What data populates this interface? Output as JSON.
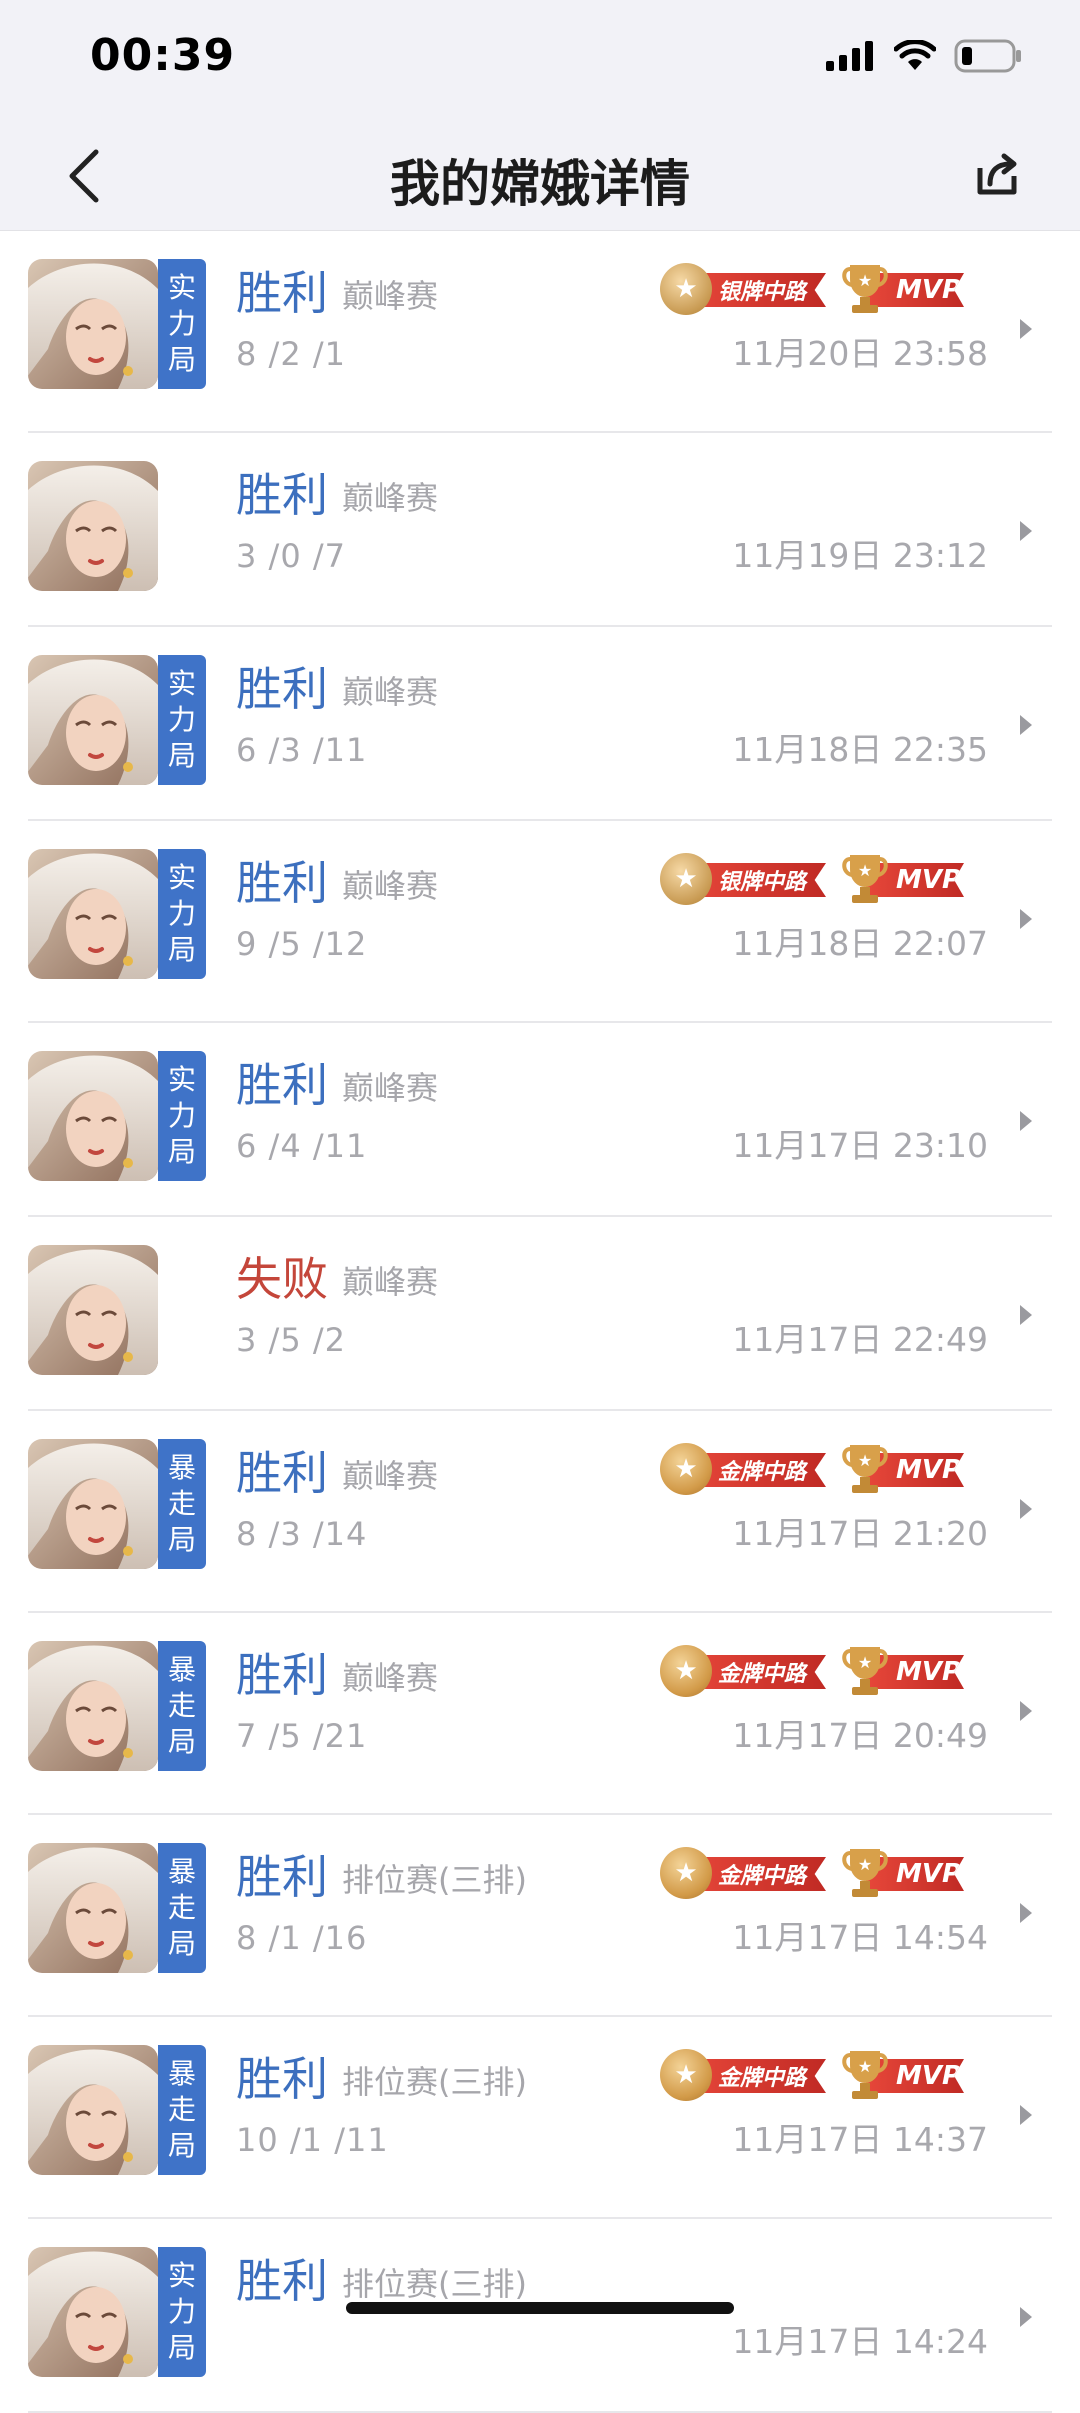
{
  "status_bar": {
    "time": "00:39"
  },
  "nav": {
    "title": "我的嫦娥详情"
  },
  "badge_labels": {
    "silver_mid": "银牌中路",
    "gold_mid": "金牌中路",
    "mvp": "MVP"
  },
  "colors": {
    "win": "#3c6fbe",
    "lose": "#c4463a",
    "tag_bg": "#3f73c8",
    "ribbon_red": "#d8372e"
  },
  "matches": [
    {
      "tag": [
        "实",
        "力",
        "局"
      ],
      "result": "胜利",
      "outcome": "win",
      "mode": "巅峰赛",
      "kda": "8 /2 /1",
      "date": "11月20日 23:58",
      "medal": "silver",
      "mvp": true
    },
    {
      "tag": [],
      "result": "胜利",
      "outcome": "win",
      "mode": "巅峰赛",
      "kda": "3 /0 /7",
      "date": "11月19日 23:12",
      "medal": null,
      "mvp": false
    },
    {
      "tag": [
        "实",
        "力",
        "局"
      ],
      "result": "胜利",
      "outcome": "win",
      "mode": "巅峰赛",
      "kda": "6 /3 /11",
      "date": "11月18日 22:35",
      "medal": null,
      "mvp": false
    },
    {
      "tag": [
        "实",
        "力",
        "局"
      ],
      "result": "胜利",
      "outcome": "win",
      "mode": "巅峰赛",
      "kda": "9 /5 /12",
      "date": "11月18日 22:07",
      "medal": "silver",
      "mvp": true
    },
    {
      "tag": [
        "实",
        "力",
        "局"
      ],
      "result": "胜利",
      "outcome": "win",
      "mode": "巅峰赛",
      "kda": "6 /4 /11",
      "date": "11月17日 23:10",
      "medal": null,
      "mvp": false
    },
    {
      "tag": [],
      "result": "失败",
      "outcome": "lose",
      "mode": "巅峰赛",
      "kda": "3 /5 /2",
      "date": "11月17日 22:49",
      "medal": null,
      "mvp": false
    },
    {
      "tag": [
        "暴",
        "走",
        "局"
      ],
      "result": "胜利",
      "outcome": "win",
      "mode": "巅峰赛",
      "kda": "8 /3 /14",
      "date": "11月17日 21:20",
      "medal": "gold",
      "mvp": true
    },
    {
      "tag": [
        "暴",
        "走",
        "局"
      ],
      "result": "胜利",
      "outcome": "win",
      "mode": "巅峰赛",
      "kda": "7 /5 /21",
      "date": "11月17日 20:49",
      "medal": "gold",
      "mvp": true
    },
    {
      "tag": [
        "暴",
        "走",
        "局"
      ],
      "result": "胜利",
      "outcome": "win",
      "mode": "排位赛(三排)",
      "kda": "8 /1 /16",
      "date": "11月17日 14:54",
      "medal": "gold",
      "mvp": true
    },
    {
      "tag": [
        "暴",
        "走",
        "局"
      ],
      "result": "胜利",
      "outcome": "win",
      "mode": "排位赛(三排)",
      "kda": "10 /1 /11",
      "date": "11月17日 14:37",
      "medal": "gold",
      "mvp": true
    },
    {
      "tag": [
        "实",
        "力",
        "局"
      ],
      "result": "胜利",
      "outcome": "win",
      "mode": "排位赛(三排)",
      "kda": "",
      "date": "11月17日 14:24",
      "medal": null,
      "mvp": false
    }
  ]
}
